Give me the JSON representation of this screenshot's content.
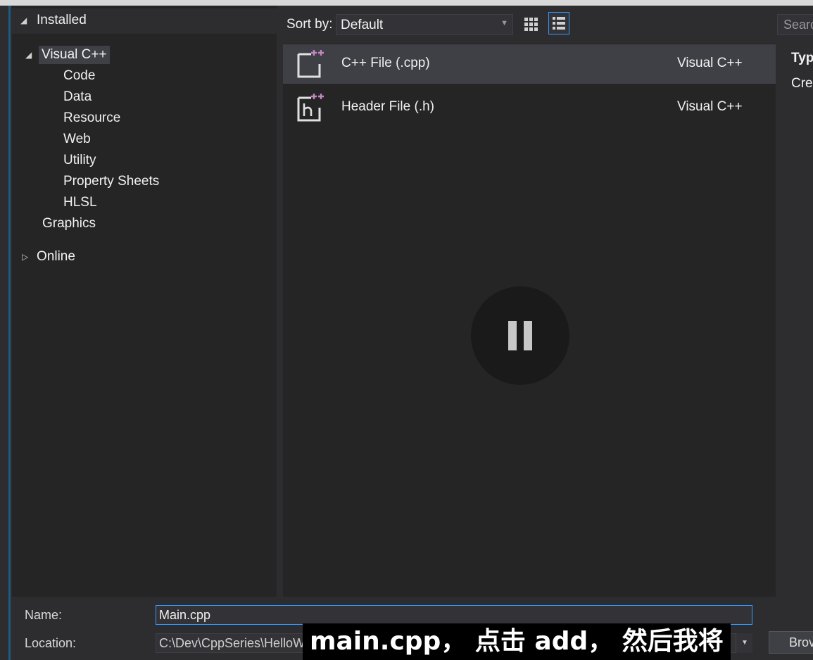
{
  "tree": {
    "installed_label": "Installed",
    "visual_cpp_label": "Visual C++",
    "children": [
      "Code",
      "Data",
      "Resource",
      "Web",
      "Utility",
      "Property Sheets",
      "HLSL"
    ],
    "graphics_label": "Graphics",
    "online_label": "Online"
  },
  "toolbar": {
    "sort_label": "Sort by:",
    "sort_value": "Default",
    "search_placeholder": "Searc"
  },
  "templates": [
    {
      "name": "C++ File (.cpp)",
      "language": "Visual C++",
      "icon": "cpp-file-icon"
    },
    {
      "name": "Header File (.h)",
      "language": "Visual C++",
      "icon": "header-file-icon"
    }
  ],
  "details": {
    "type_label": "Typ",
    "description": "Crea"
  },
  "form": {
    "name_label": "Name:",
    "name_value": "Main.cpp",
    "location_label": "Location:",
    "location_value": "C:\\Dev\\CppSeries\\HelloW",
    "browse_label": "Brov"
  },
  "subtitle": "main.cpp， 点击 add， 然后我将",
  "colors": {
    "accent": "#3399ff",
    "background": "#2d2d30",
    "panel": "#252526",
    "selection": "#3f3f46"
  }
}
